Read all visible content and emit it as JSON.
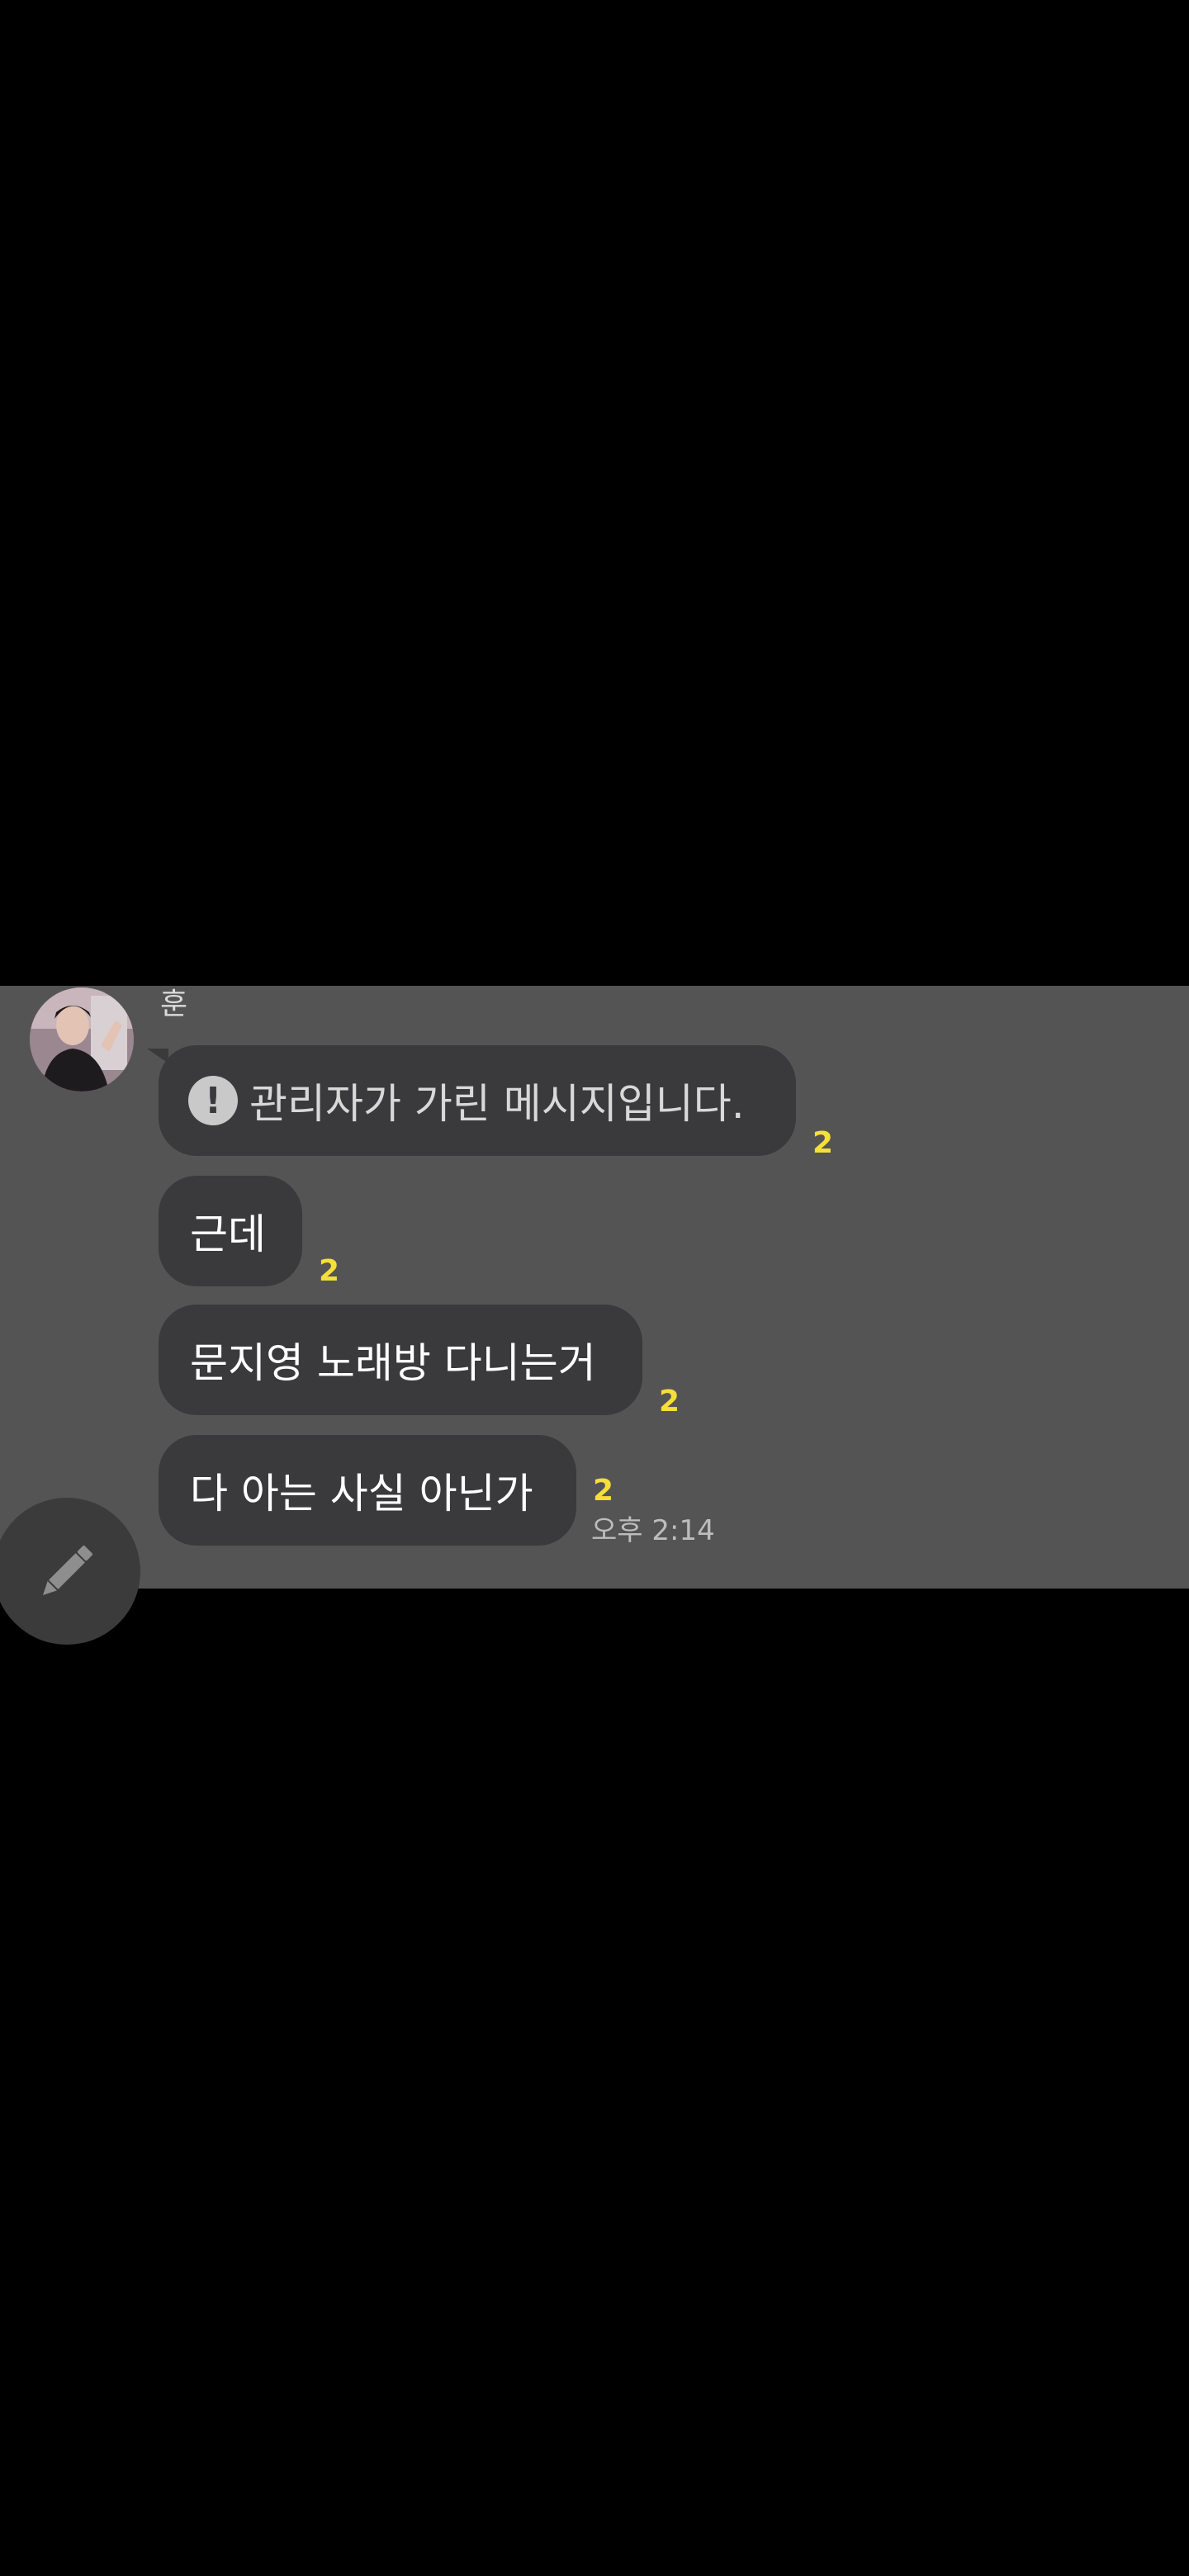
{
  "chat": {
    "sender_name": "훈",
    "messages": [
      {
        "text": "관리자가 가린 메시지입니다.",
        "unread": "2",
        "is_notice": true
      },
      {
        "text": "근데",
        "unread": "2"
      },
      {
        "text": "문지영 노래방 다니는거",
        "unread": "2"
      },
      {
        "text": "다 아는 사실 아닌가",
        "unread": "2",
        "time": "오후 2:14"
      }
    ],
    "notice_icon_glyph": "!"
  },
  "icons": {
    "avatar": "profile-photo",
    "notice": "exclamation-circle-icon",
    "compose": "pencil-icon"
  },
  "colors": {
    "page_background": "#000000",
    "chat_background": "#555455",
    "bubble": "#3a393b",
    "unread_count": "#f5df3a",
    "message_text": "#ffffff"
  }
}
